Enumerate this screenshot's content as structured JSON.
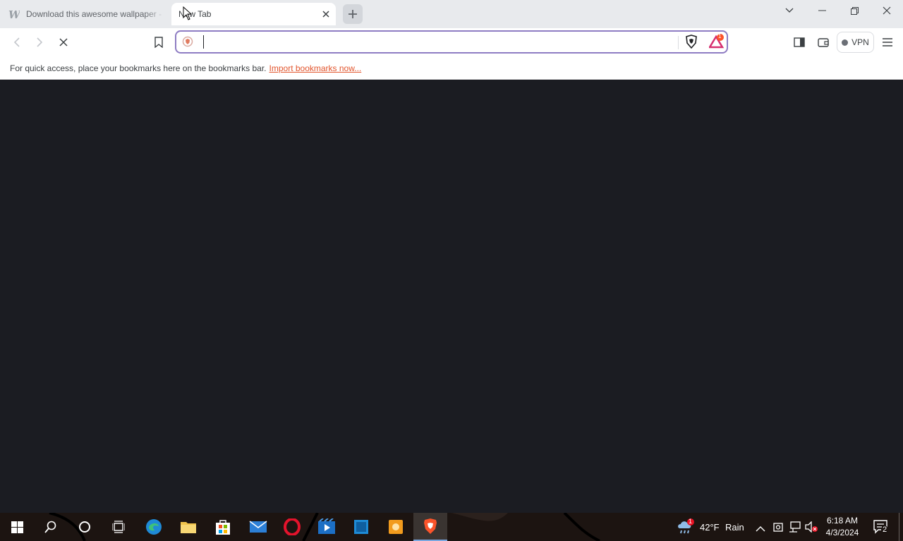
{
  "tabs": [
    {
      "title": "Download this awesome wallpaper -",
      "favicon": "w-logo-icon",
      "active": false
    },
    {
      "title": "New Tab",
      "favicon": "none",
      "active": true
    }
  ],
  "omnibox": {
    "value": "",
    "placeholder": ""
  },
  "vpn_label": "VPN",
  "rewards_badge": "1",
  "bookmarks_bar": {
    "message": "For quick access, place your bookmarks here on the bookmarks bar.",
    "import_link": "Import bookmarks now..."
  },
  "taskbar": {
    "weather_temp": "42°F",
    "weather_desc": "Rain",
    "weather_badge": "1",
    "time": "6:18 AM",
    "date": "4/3/2024",
    "notification_count": "2"
  },
  "colors": {
    "accent_border": "#8e7cc3",
    "brave_orange": "#fb542b",
    "page_bg": "#1b1c22"
  }
}
